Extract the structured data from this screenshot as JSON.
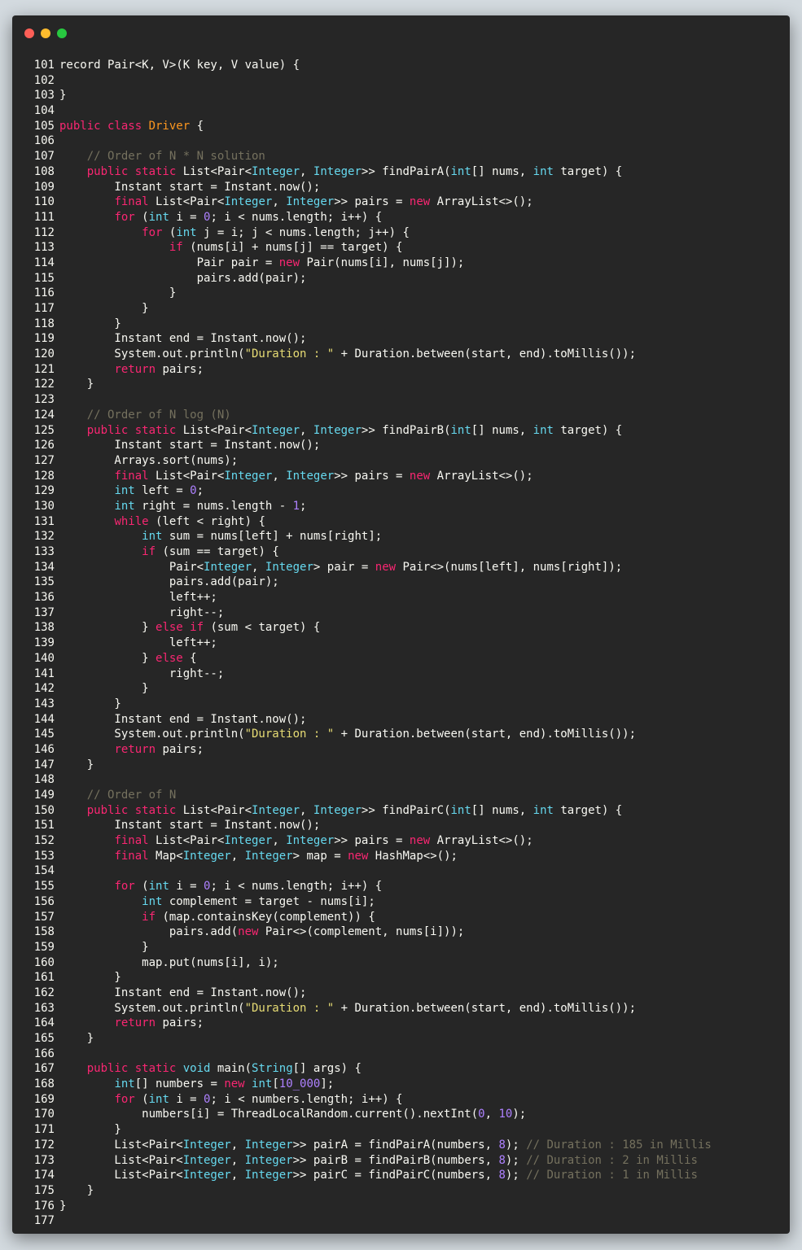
{
  "colors": {
    "background": "#d3dadf",
    "window": "#262626",
    "text": "#f8f8f2",
    "keyword": "#f92672",
    "type": "#66d9ef",
    "class_name": "#fd971f",
    "number": "#ae81ff",
    "string": "#e6db74",
    "comment": "#75715e"
  },
  "window_controls": [
    "close",
    "minimize",
    "maximize"
  ],
  "lines": [
    {
      "n": "101",
      "t": [
        [
          "p",
          "record Pair<K, V>(K key, V value) {"
        ]
      ]
    },
    {
      "n": "102",
      "t": []
    },
    {
      "n": "103",
      "t": [
        [
          "p",
          "}"
        ]
      ]
    },
    {
      "n": "104",
      "t": []
    },
    {
      "n": "105",
      "t": [
        [
          "kw",
          "public class "
        ],
        [
          "cls",
          "Driver"
        ],
        [
          "p",
          " {"
        ]
      ]
    },
    {
      "n": "106",
      "t": []
    },
    {
      "n": "107",
      "t": [
        [
          "p",
          "    "
        ],
        [
          "cm",
          "// Order of N * N solution"
        ]
      ]
    },
    {
      "n": "108",
      "t": [
        [
          "p",
          "    "
        ],
        [
          "kw",
          "public static "
        ],
        [
          "p",
          "List<Pair<"
        ],
        [
          "ty",
          "Integer"
        ],
        [
          "p",
          ", "
        ],
        [
          "ty",
          "Integer"
        ],
        [
          "p",
          ">> findPairA("
        ],
        [
          "ty",
          "int"
        ],
        [
          "p",
          "[] nums, "
        ],
        [
          "ty",
          "int"
        ],
        [
          "p",
          " target) {"
        ]
      ]
    },
    {
      "n": "109",
      "t": [
        [
          "p",
          "        Instant start = Instant.now();"
        ]
      ]
    },
    {
      "n": "110",
      "t": [
        [
          "p",
          "        "
        ],
        [
          "kw",
          "final "
        ],
        [
          "p",
          "List<Pair<"
        ],
        [
          "ty",
          "Integer"
        ],
        [
          "p",
          ", "
        ],
        [
          "ty",
          "Integer"
        ],
        [
          "p",
          ">> pairs = "
        ],
        [
          "kw",
          "new "
        ],
        [
          "p",
          "ArrayList<>();"
        ]
      ]
    },
    {
      "n": "111",
      "t": [
        [
          "p",
          "        "
        ],
        [
          "kw",
          "for "
        ],
        [
          "p",
          "("
        ],
        [
          "ty",
          "int"
        ],
        [
          "p",
          " i = "
        ],
        [
          "num",
          "0"
        ],
        [
          "p",
          "; i < nums.length; i++) {"
        ]
      ]
    },
    {
      "n": "112",
      "t": [
        [
          "p",
          "            "
        ],
        [
          "kw",
          "for "
        ],
        [
          "p",
          "("
        ],
        [
          "ty",
          "int"
        ],
        [
          "p",
          " j = i; j < nums.length; j++) {"
        ]
      ]
    },
    {
      "n": "113",
      "t": [
        [
          "p",
          "                "
        ],
        [
          "kw",
          "if "
        ],
        [
          "p",
          "(nums[i] + nums[j] == target) {"
        ]
      ]
    },
    {
      "n": "114",
      "t": [
        [
          "p",
          "                    Pair pair = "
        ],
        [
          "kw",
          "new "
        ],
        [
          "p",
          "Pair(nums[i], nums[j]);"
        ]
      ]
    },
    {
      "n": "115",
      "t": [
        [
          "p",
          "                    pairs.add(pair);"
        ]
      ]
    },
    {
      "n": "116",
      "t": [
        [
          "p",
          "                }"
        ]
      ]
    },
    {
      "n": "117",
      "t": [
        [
          "p",
          "            }"
        ]
      ]
    },
    {
      "n": "118",
      "t": [
        [
          "p",
          "        }"
        ]
      ]
    },
    {
      "n": "119",
      "t": [
        [
          "p",
          "        Instant end = Instant.now();"
        ]
      ]
    },
    {
      "n": "120",
      "t": [
        [
          "p",
          "        System.out.println("
        ],
        [
          "str",
          "\"Duration : \""
        ],
        [
          "p",
          " + Duration.between(start, end).toMillis());"
        ]
      ]
    },
    {
      "n": "121",
      "t": [
        [
          "p",
          "        "
        ],
        [
          "kw",
          "return "
        ],
        [
          "p",
          "pairs;"
        ]
      ]
    },
    {
      "n": "122",
      "t": [
        [
          "p",
          "    }"
        ]
      ]
    },
    {
      "n": "123",
      "t": []
    },
    {
      "n": "124",
      "t": [
        [
          "p",
          "    "
        ],
        [
          "cm",
          "// Order of N log (N)"
        ]
      ]
    },
    {
      "n": "125",
      "t": [
        [
          "p",
          "    "
        ],
        [
          "kw",
          "public static "
        ],
        [
          "p",
          "List<Pair<"
        ],
        [
          "ty",
          "Integer"
        ],
        [
          "p",
          ", "
        ],
        [
          "ty",
          "Integer"
        ],
        [
          "p",
          ">> findPairB("
        ],
        [
          "ty",
          "int"
        ],
        [
          "p",
          "[] nums, "
        ],
        [
          "ty",
          "int"
        ],
        [
          "p",
          " target) {"
        ]
      ]
    },
    {
      "n": "126",
      "t": [
        [
          "p",
          "        Instant start = Instant.now();"
        ]
      ]
    },
    {
      "n": "127",
      "t": [
        [
          "p",
          "        Arrays.sort(nums);"
        ]
      ]
    },
    {
      "n": "128",
      "t": [
        [
          "p",
          "        "
        ],
        [
          "kw",
          "final "
        ],
        [
          "p",
          "List<Pair<"
        ],
        [
          "ty",
          "Integer"
        ],
        [
          "p",
          ", "
        ],
        [
          "ty",
          "Integer"
        ],
        [
          "p",
          ">> pairs = "
        ],
        [
          "kw",
          "new "
        ],
        [
          "p",
          "ArrayList<>();"
        ]
      ]
    },
    {
      "n": "129",
      "t": [
        [
          "p",
          "        "
        ],
        [
          "ty",
          "int"
        ],
        [
          "p",
          " left = "
        ],
        [
          "num",
          "0"
        ],
        [
          "p",
          ";"
        ]
      ]
    },
    {
      "n": "130",
      "t": [
        [
          "p",
          "        "
        ],
        [
          "ty",
          "int"
        ],
        [
          "p",
          " right = nums.length - "
        ],
        [
          "num",
          "1"
        ],
        [
          "p",
          ";"
        ]
      ]
    },
    {
      "n": "131",
      "t": [
        [
          "p",
          "        "
        ],
        [
          "kw",
          "while "
        ],
        [
          "p",
          "(left < right) {"
        ]
      ]
    },
    {
      "n": "132",
      "t": [
        [
          "p",
          "            "
        ],
        [
          "ty",
          "int"
        ],
        [
          "p",
          " sum = nums[left] + nums[right];"
        ]
      ]
    },
    {
      "n": "133",
      "t": [
        [
          "p",
          "            "
        ],
        [
          "kw",
          "if "
        ],
        [
          "p",
          "(sum == target) {"
        ]
      ]
    },
    {
      "n": "134",
      "t": [
        [
          "p",
          "                Pair<"
        ],
        [
          "ty",
          "Integer"
        ],
        [
          "p",
          ", "
        ],
        [
          "ty",
          "Integer"
        ],
        [
          "p",
          "> pair = "
        ],
        [
          "kw",
          "new "
        ],
        [
          "p",
          "Pair<>(nums[left], nums[right]);"
        ]
      ]
    },
    {
      "n": "135",
      "t": [
        [
          "p",
          "                pairs.add(pair);"
        ]
      ]
    },
    {
      "n": "136",
      "t": [
        [
          "p",
          "                left++;"
        ]
      ]
    },
    {
      "n": "137",
      "t": [
        [
          "p",
          "                right--;"
        ]
      ]
    },
    {
      "n": "138",
      "t": [
        [
          "p",
          "            } "
        ],
        [
          "kw",
          "else if "
        ],
        [
          "p",
          "(sum < target) {"
        ]
      ]
    },
    {
      "n": "139",
      "t": [
        [
          "p",
          "                left++;"
        ]
      ]
    },
    {
      "n": "140",
      "t": [
        [
          "p",
          "            } "
        ],
        [
          "kw",
          "else "
        ],
        [
          "p",
          "{"
        ]
      ]
    },
    {
      "n": "141",
      "t": [
        [
          "p",
          "                right--;"
        ]
      ]
    },
    {
      "n": "142",
      "t": [
        [
          "p",
          "            }"
        ]
      ]
    },
    {
      "n": "143",
      "t": [
        [
          "p",
          "        }"
        ]
      ]
    },
    {
      "n": "144",
      "t": [
        [
          "p",
          "        Instant end = Instant.now();"
        ]
      ]
    },
    {
      "n": "145",
      "t": [
        [
          "p",
          "        System.out.println("
        ],
        [
          "str",
          "\"Duration : \""
        ],
        [
          "p",
          " + Duration.between(start, end).toMillis());"
        ]
      ]
    },
    {
      "n": "146",
      "t": [
        [
          "p",
          "        "
        ],
        [
          "kw",
          "return "
        ],
        [
          "p",
          "pairs;"
        ]
      ]
    },
    {
      "n": "147",
      "t": [
        [
          "p",
          "    }"
        ]
      ]
    },
    {
      "n": "148",
      "t": []
    },
    {
      "n": "149",
      "t": [
        [
          "p",
          "    "
        ],
        [
          "cm",
          "// Order of N"
        ]
      ]
    },
    {
      "n": "150",
      "t": [
        [
          "p",
          "    "
        ],
        [
          "kw",
          "public static "
        ],
        [
          "p",
          "List<Pair<"
        ],
        [
          "ty",
          "Integer"
        ],
        [
          "p",
          ", "
        ],
        [
          "ty",
          "Integer"
        ],
        [
          "p",
          ">> findPairC("
        ],
        [
          "ty",
          "int"
        ],
        [
          "p",
          "[] nums, "
        ],
        [
          "ty",
          "int"
        ],
        [
          "p",
          " target) {"
        ]
      ]
    },
    {
      "n": "151",
      "t": [
        [
          "p",
          "        Instant start = Instant.now();"
        ]
      ]
    },
    {
      "n": "152",
      "t": [
        [
          "p",
          "        "
        ],
        [
          "kw",
          "final "
        ],
        [
          "p",
          "List<Pair<"
        ],
        [
          "ty",
          "Integer"
        ],
        [
          "p",
          ", "
        ],
        [
          "ty",
          "Integer"
        ],
        [
          "p",
          ">> pairs = "
        ],
        [
          "kw",
          "new "
        ],
        [
          "p",
          "ArrayList<>();"
        ]
      ]
    },
    {
      "n": "153",
      "t": [
        [
          "p",
          "        "
        ],
        [
          "kw",
          "final "
        ],
        [
          "p",
          "Map<"
        ],
        [
          "ty",
          "Integer"
        ],
        [
          "p",
          ", "
        ],
        [
          "ty",
          "Integer"
        ],
        [
          "p",
          "> map = "
        ],
        [
          "kw",
          "new "
        ],
        [
          "p",
          "HashMap<>();"
        ]
      ]
    },
    {
      "n": "154",
      "t": []
    },
    {
      "n": "155",
      "t": [
        [
          "p",
          "        "
        ],
        [
          "kw",
          "for "
        ],
        [
          "p",
          "("
        ],
        [
          "ty",
          "int"
        ],
        [
          "p",
          " i = "
        ],
        [
          "num",
          "0"
        ],
        [
          "p",
          "; i < nums.length; i++) {"
        ]
      ]
    },
    {
      "n": "156",
      "t": [
        [
          "p",
          "            "
        ],
        [
          "ty",
          "int"
        ],
        [
          "p",
          " complement = target - nums[i];"
        ]
      ]
    },
    {
      "n": "157",
      "t": [
        [
          "p",
          "            "
        ],
        [
          "kw",
          "if "
        ],
        [
          "p",
          "(map.containsKey(complement)) {"
        ]
      ]
    },
    {
      "n": "158",
      "t": [
        [
          "p",
          "                pairs.add("
        ],
        [
          "kw",
          "new "
        ],
        [
          "p",
          "Pair<>(complement, nums[i]));"
        ]
      ]
    },
    {
      "n": "159",
      "t": [
        [
          "p",
          "            }"
        ]
      ]
    },
    {
      "n": "160",
      "t": [
        [
          "p",
          "            map.put(nums[i], i);"
        ]
      ]
    },
    {
      "n": "161",
      "t": [
        [
          "p",
          "        }"
        ]
      ]
    },
    {
      "n": "162",
      "t": [
        [
          "p",
          "        Instant end = Instant.now();"
        ]
      ]
    },
    {
      "n": "163",
      "t": [
        [
          "p",
          "        System.out.println("
        ],
        [
          "str",
          "\"Duration : \""
        ],
        [
          "p",
          " + Duration.between(start, end).toMillis());"
        ]
      ]
    },
    {
      "n": "164",
      "t": [
        [
          "p",
          "        "
        ],
        [
          "kw",
          "return "
        ],
        [
          "p",
          "pairs;"
        ]
      ]
    },
    {
      "n": "165",
      "t": [
        [
          "p",
          "    }"
        ]
      ]
    },
    {
      "n": "166",
      "t": []
    },
    {
      "n": "167",
      "t": [
        [
          "p",
          "    "
        ],
        [
          "kw",
          "public static "
        ],
        [
          "ty",
          "void "
        ],
        [
          "p",
          "main("
        ],
        [
          "ty",
          "String"
        ],
        [
          "p",
          "[] args) {"
        ]
      ]
    },
    {
      "n": "168",
      "t": [
        [
          "p",
          "        "
        ],
        [
          "ty",
          "int"
        ],
        [
          "p",
          "[] numbers = "
        ],
        [
          "kw",
          "new "
        ],
        [
          "ty",
          "int"
        ],
        [
          "p",
          "["
        ],
        [
          "num",
          "10_000"
        ],
        [
          "p",
          "];"
        ]
      ]
    },
    {
      "n": "169",
      "t": [
        [
          "p",
          "        "
        ],
        [
          "kw",
          "for "
        ],
        [
          "p",
          "("
        ],
        [
          "ty",
          "int"
        ],
        [
          "p",
          " i = "
        ],
        [
          "num",
          "0"
        ],
        [
          "p",
          "; i < numbers.length; i++) {"
        ]
      ]
    },
    {
      "n": "170",
      "t": [
        [
          "p",
          "            numbers[i] = ThreadLocalRandom.current().nextInt("
        ],
        [
          "num",
          "0"
        ],
        [
          "p",
          ", "
        ],
        [
          "num",
          "10"
        ],
        [
          "p",
          ");"
        ]
      ]
    },
    {
      "n": "171",
      "t": [
        [
          "p",
          "        }"
        ]
      ]
    },
    {
      "n": "172",
      "t": [
        [
          "p",
          "        List<Pair<"
        ],
        [
          "ty",
          "Integer"
        ],
        [
          "p",
          ", "
        ],
        [
          "ty",
          "Integer"
        ],
        [
          "p",
          ">> pairA = findPairA(numbers, "
        ],
        [
          "num",
          "8"
        ],
        [
          "p",
          "); "
        ],
        [
          "cm",
          "// Duration : 185 in Millis"
        ]
      ]
    },
    {
      "n": "173",
      "t": [
        [
          "p",
          "        List<Pair<"
        ],
        [
          "ty",
          "Integer"
        ],
        [
          "p",
          ", "
        ],
        [
          "ty",
          "Integer"
        ],
        [
          "p",
          ">> pairB = findPairB(numbers, "
        ],
        [
          "num",
          "8"
        ],
        [
          "p",
          "); "
        ],
        [
          "cm",
          "// Duration : 2 in Millis"
        ]
      ]
    },
    {
      "n": "174",
      "t": [
        [
          "p",
          "        List<Pair<"
        ],
        [
          "ty",
          "Integer"
        ],
        [
          "p",
          ", "
        ],
        [
          "ty",
          "Integer"
        ],
        [
          "p",
          ">> pairC = findPairC(numbers, "
        ],
        [
          "num",
          "8"
        ],
        [
          "p",
          "); "
        ],
        [
          "cm",
          "// Duration : 1 in Millis"
        ]
      ]
    },
    {
      "n": "175",
      "t": [
        [
          "p",
          "    }"
        ]
      ]
    },
    {
      "n": "176",
      "t": [
        [
          "p",
          "}"
        ]
      ]
    },
    {
      "n": "177",
      "t": []
    }
  ]
}
